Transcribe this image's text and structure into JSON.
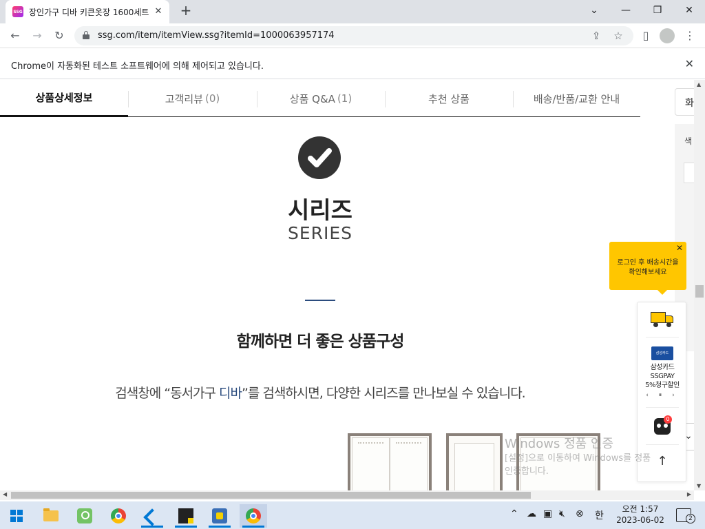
{
  "browser": {
    "tab": {
      "favicon_text": "SSG",
      "title": "장인가구 디바 키큰옷장 1600세트",
      "close_icon": "close-icon"
    },
    "new_tab_label": "+",
    "window_controls": [
      "minimize",
      "restore",
      "close"
    ],
    "url": "ssg.com/item/itemView.ssg?itemId=1000063957174",
    "infobar_text": "Chrome이 자동화된 테스트 소프트웨어에 의해 제어되고 있습니다."
  },
  "page": {
    "tabs": [
      {
        "label": "상품상세정보",
        "count": ""
      },
      {
        "label": "고객리뷰",
        "count": "(0)"
      },
      {
        "label": "상품 Q&A",
        "count": "(1)"
      },
      {
        "label": "추천 상품",
        "count": ""
      },
      {
        "label": "배송/반품/교환 안내",
        "count": ""
      }
    ],
    "series_title_ko": "시리즈",
    "series_title_en": "SERIES",
    "combo_title": "함께하면 더 좋은 상품구성",
    "combo_desc_before": "검색창에 “동서가구 ",
    "combo_desc_highlight": "디바",
    "combo_desc_after": "”를 검색하시면, 다양한 시리즈를 만나보실 수 있습니다.",
    "sidebar_partial": {
      "top_button": "화",
      "label": "색",
      "bottom_icon": "chevron-down-icon"
    },
    "tooltip": "로그인 후 배송시간을\n확인해보세요",
    "quick_menu": {
      "card_logo": "삼성카드",
      "card_text": "삼성카드\nSSGPAY\n5%청구할인",
      "card_nav": "‹ ⏸ ›",
      "bot_badge": "0",
      "top_icon": "↑"
    },
    "watermark_title": "Windows 정품 인증",
    "watermark_body": "[설정]으로 이동하여 Windows를 정품\n인증합니다."
  },
  "taskbar": {
    "apps": [
      "start",
      "file-explorer",
      "maps",
      "chrome",
      "vscode",
      "stickies",
      "python-app",
      "chrome-active"
    ],
    "tray_ime": "한",
    "time": "오전 1:57",
    "date": "2023-06-02",
    "notification_count": "2"
  },
  "colors": {
    "accent_navy": "#2b4c7e",
    "tooltip_yellow": "#ffc600",
    "windows_blue": "#0078d4"
  }
}
